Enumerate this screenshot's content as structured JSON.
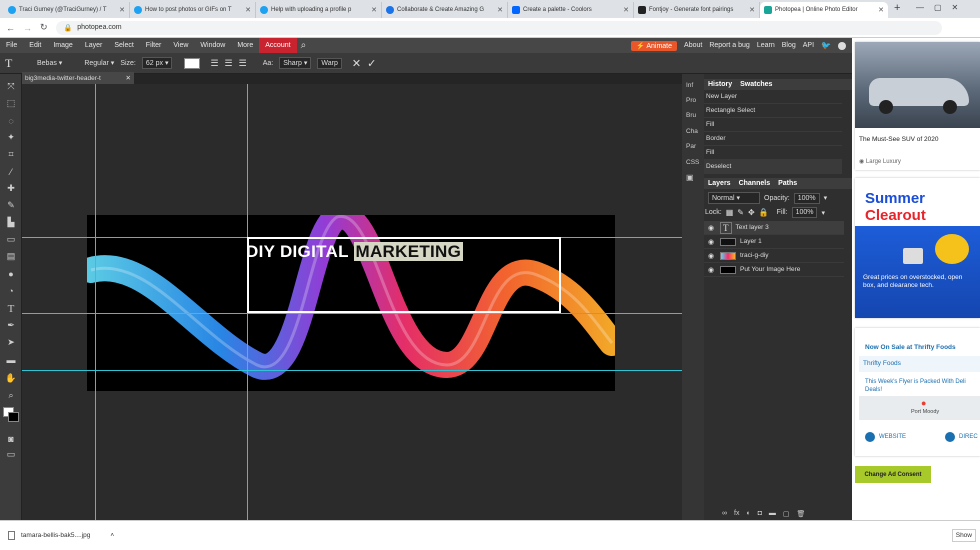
{
  "browser": {
    "tabs": [
      {
        "label": "Traci Gurney (@TraciGurney) / T",
        "icon": "twitter-icon",
        "color": "#1da1f2"
      },
      {
        "label": "How to post photos or GIFs on T",
        "icon": "twitter-icon",
        "color": "#1da1f2"
      },
      {
        "label": "Help with uploading a profile p",
        "icon": "twitter-icon",
        "color": "#1da1f2"
      },
      {
        "label": "Collaborate & Create Amazing G",
        "icon": "canva-icon",
        "color": "#1a73e8"
      },
      {
        "label": "Create a palette - Coolors",
        "icon": "coolors-icon",
        "color": "#0066ff"
      },
      {
        "label": "Fontjoy - Generate font pairings",
        "icon": "fontjoy-icon",
        "color": "#222222"
      },
      {
        "label": "Photopea | Online Photo Editor",
        "icon": "photopea-icon",
        "color": "#18a497"
      }
    ],
    "url": "photopea.com"
  },
  "menu": {
    "items": [
      "File",
      "Edit",
      "Image",
      "Layer",
      "Select",
      "Filter",
      "View",
      "Window",
      "More",
      "Account"
    ],
    "right": [
      "About",
      "Report a bug",
      "Learn",
      "Blog",
      "API"
    ],
    "animate": "Animate"
  },
  "options": {
    "font": "Bebas",
    "style": "Regular",
    "size_label": "Size:",
    "size": "62 px",
    "aa_label": "Aa:",
    "aa": "Sharp",
    "warp": "Warp"
  },
  "document": {
    "tab": "big3media-twitter-header-t",
    "headline_plain": "DIY DIGITAL",
    "headline_selected": "MARKETING"
  },
  "panels": {
    "side_icons": [
      "Inf",
      "Pro",
      "Bru",
      "Cha",
      "Par",
      "CSS"
    ],
    "history_tabs": [
      "History",
      "Swatches"
    ],
    "history": [
      "New Layer",
      "Rectangle Select",
      "Fill",
      "Border",
      "Fill",
      "Deselect"
    ],
    "layer_tabs": [
      "Layers",
      "Channels",
      "Paths"
    ],
    "blend": "Normal",
    "opacity_label": "Opacity:",
    "opacity": "100%",
    "lock_label": "Lock:",
    "fill_label": "Fill:",
    "fill": "100%",
    "layers": [
      "Text layer 3",
      "Layer 1",
      "traci-g-diy",
      "Put Your Image Here"
    ]
  },
  "ads": {
    "ad_label": "Ad",
    "car_title": "The Must-See SUV of 2020",
    "car_sponsor": "Large Luxury",
    "summer_title_1": "Summer",
    "summer_title_2": "Clearout",
    "summer_text": "Great prices on overstocked, open box, and clearance tech.",
    "thrifty_title": "Now On Sale at Thrifty Foods",
    "thrifty_brand": "Thrifty Foods",
    "thrifty_link": "This Week's Flyer is Packed With Deli Deals!",
    "thrifty_place": "Port Moody",
    "website": "WEBSITE",
    "directions": "DIREC",
    "consent": "Change Ad Consent"
  },
  "download": {
    "file": "tamara-bellis-bak5....jpg",
    "show": "Show"
  }
}
